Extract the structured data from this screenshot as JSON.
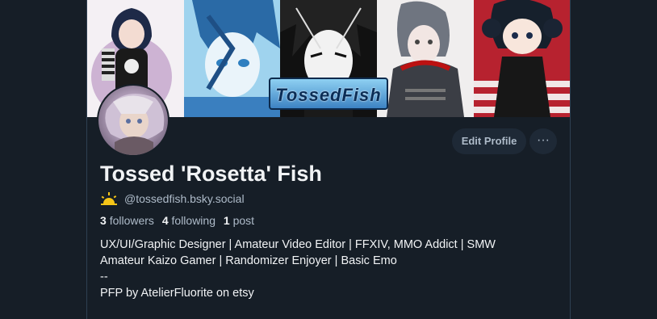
{
  "banner": {
    "logo_text": "TossedFish"
  },
  "profile": {
    "name": "Tossed 'Rosetta' Fish",
    "handle": "@tossedfish.bsky.social",
    "followers_count": "3",
    "followers_label": "followers",
    "following_count": "4",
    "following_label": "following",
    "posts_count": "1",
    "posts_label": "post",
    "bio_lines": [
      "UX/UI/Graphic Designer | Amateur Video Editor | FFXIV, MMO Addict | SMW",
      "Amateur Kaizo Gamer | Randomizer Enjoyer | Basic Emo",
      "--",
      "PFP by AtelierFluorite on etsy"
    ]
  },
  "actions": {
    "edit_profile_label": "Edit Profile",
    "more_label": "···"
  },
  "icons": {
    "handle_badge": "sun-icon"
  },
  "colors": {
    "background": "#161e27",
    "button_bg": "#1e2936",
    "muted_text": "#aebbc9",
    "primary_text": "#f1f3f5",
    "sun": "#f5c518"
  }
}
